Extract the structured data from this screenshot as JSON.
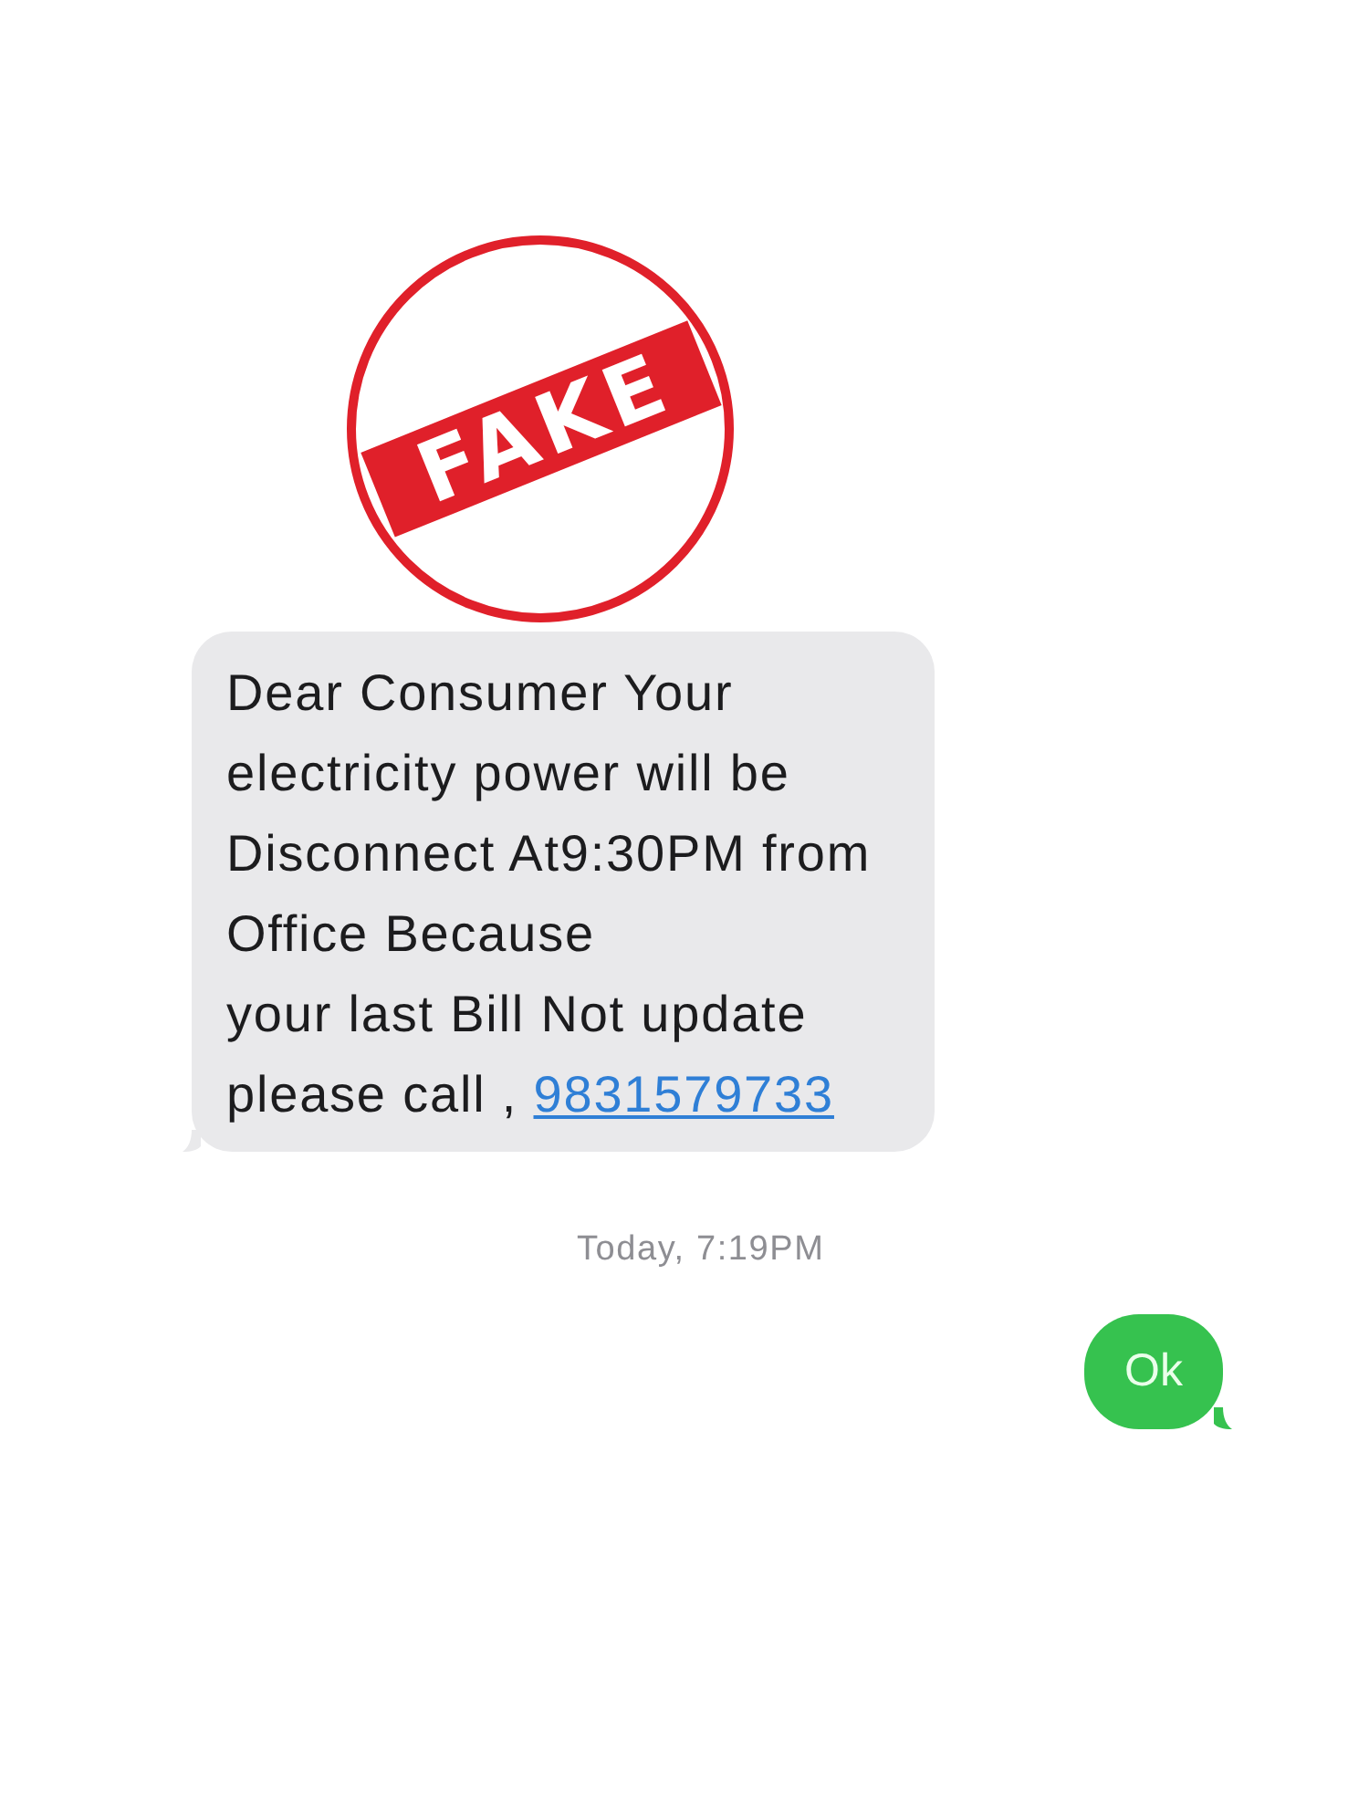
{
  "stamp": {
    "label": "FAKE"
  },
  "messages": [
    {
      "kind": "incoming",
      "text": "Dear Consumer Your electricity power will be Disconnect At9:30PM from Office Because\nyour last Bill Not update please call , ",
      "link": "9831579733"
    },
    {
      "kind": "timestamp",
      "text": "Today, 7:19PM"
    },
    {
      "kind": "outgoing",
      "text": "Ok"
    }
  ]
}
